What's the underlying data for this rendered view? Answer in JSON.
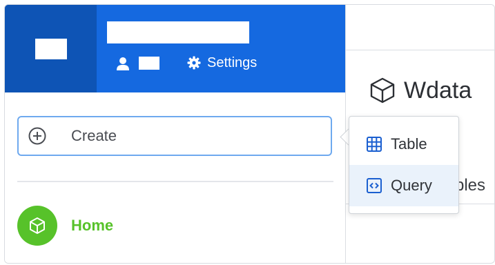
{
  "header": {
    "settings_label": "Settings",
    "icons": [
      "user-icon",
      "gear-icon"
    ]
  },
  "sidebar": {
    "create_label": "Create",
    "home_label": "Home",
    "icons": [
      "plus-circle-icon",
      "cube-icon"
    ]
  },
  "main": {
    "dataset_title": "Wdata",
    "tab_fragment": "bles"
  },
  "create_menu": {
    "items": [
      {
        "label": "Table",
        "icon": "table-icon"
      },
      {
        "label": "Query",
        "icon": "code-icon"
      }
    ]
  },
  "colors": {
    "header_blue": "#1569e0",
    "logo_blue": "#0e54b5",
    "home_green": "#57c22a",
    "focus_border": "#6ea9ef",
    "menu_highlight": "#eaf2fb"
  }
}
